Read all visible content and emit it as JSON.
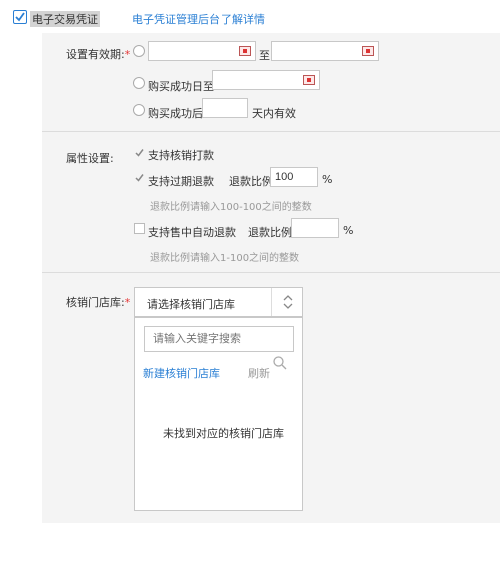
{
  "header": {
    "checkbox_label": "电子交易凭证",
    "admin_link": "电子凭证管理后台",
    "learn_more_link": "了解详情"
  },
  "validity": {
    "label": "设置有效期:",
    "required_mark": "*",
    "range_separator": "至",
    "option_until_label": "购买成功日至",
    "option_days_prefix": "购买成功后",
    "option_days_suffix": "天内有效"
  },
  "attributes": {
    "label": "属性设置:",
    "support_redeem_label": "支持核销打款",
    "support_expired_refund_label": "支持过期退款",
    "refund_ratio_label": "退款比例",
    "refund_ratio_value": "100",
    "percent_sign": "%",
    "hint_1": "退款比例请输入100-100之间的整数",
    "support_auto_refund_label": "支持售中自动退款",
    "auto_refund_ratio_label": "退款比例",
    "auto_refund_ratio_value": "",
    "percent_sign_2": "%",
    "hint_2": "退款比例请输入1-100之间的整数"
  },
  "store": {
    "label": "核销门店库:",
    "required_mark": "*",
    "select_placeholder": "请选择核销门店库",
    "search_placeholder": "请输入关键字搜索",
    "new_store_link": "新建核销门店库",
    "refresh_label": "刷新",
    "empty_message": "未找到对应的核销门店库"
  },
  "icons": {
    "checkbox": "checkmark-icon",
    "calendar": "calendar-icon",
    "select": "updown-chevron-icon",
    "search": "search-icon"
  },
  "colors": {
    "link": "#2a7fd4",
    "required": "#e53333",
    "panel_bg": "#f4f4f4"
  }
}
